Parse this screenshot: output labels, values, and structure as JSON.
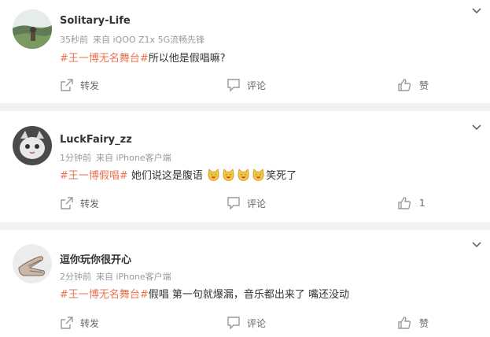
{
  "comments": [
    {
      "username": "Solitary-Life",
      "time": "35秒前",
      "source": "来自 iQOO Z1x 5G流畅先锋",
      "topic": "#王一博无名舞台#",
      "text": "所以他是假唱嘛?",
      "repost_label": "转发",
      "comment_label": "评论",
      "like_label": "赞"
    },
    {
      "username": "LuckFairy_zz",
      "time": "1分钟前",
      "source": "来自 iPhone客户端",
      "topic": "#王一博假唱#",
      "text": " 她们说这是腹语",
      "text_after": "笑死了",
      "emoji_count": 4,
      "repost_label": "转发",
      "comment_label": "评论",
      "like_label": "1"
    },
    {
      "username": "逗你玩你很开心",
      "time": "2分钟前",
      "source": "来自 iPhone客户端",
      "topic": "#王一博无名舞台#",
      "text": "假唱 第一句就爆漏，音乐都出来了 嘴还没动",
      "repost_label": "转发",
      "comment_label": "评论",
      "like_label": "赞"
    }
  ],
  "colors": {
    "topic": "#eb7350",
    "meta": "#999999",
    "action": "#666666",
    "background": "#f2f2f5"
  },
  "icons": {
    "repost": "share-arrow-icon",
    "comment": "chat-bubble-icon",
    "like": "thumbs-up-icon",
    "menu": "chevron-down-icon",
    "emoji": "laughing-face-emoji"
  }
}
